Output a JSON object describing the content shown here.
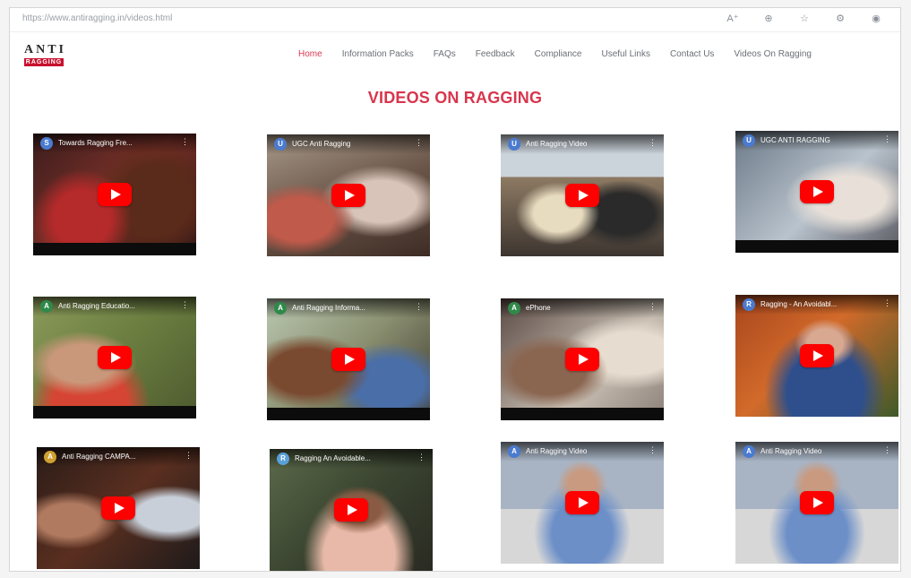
{
  "browser": {
    "url": "https://www.antiragging.in/videos.html",
    "icons": [
      "reader-icon",
      "zoom-icon",
      "favorite-icon",
      "extensions-icon",
      "profile-icon"
    ]
  },
  "site": {
    "logo_text": "ANTI",
    "logo_sub": "RAGGING"
  },
  "nav": {
    "items": [
      {
        "label": "Home",
        "active": true
      },
      {
        "label": "Information Packs",
        "active": false
      },
      {
        "label": "FAQs",
        "active": false
      },
      {
        "label": "Feedback",
        "active": false
      },
      {
        "label": "Compliance",
        "active": false
      },
      {
        "label": "Useful Links",
        "active": false
      },
      {
        "label": "Contact Us",
        "active": false
      },
      {
        "label": "Videos On Ragging",
        "active": false
      }
    ]
  },
  "page": {
    "title": "VIDEOS ON RAGGING"
  },
  "videos": [
    {
      "title": "Towards Ragging Fre...",
      "channel": "S"
    },
    {
      "title": "UGC Anti Ragging",
      "channel": "U"
    },
    {
      "title": "Anti Ragging Video",
      "channel": "U"
    },
    {
      "title": "UGC ANTI RAGGING",
      "channel": "U"
    },
    {
      "title": "Anti Ragging Educatio...",
      "channel": "A"
    },
    {
      "title": "Anti Ragging Informa...",
      "channel": "A"
    },
    {
      "title": "ePhone",
      "channel": "A"
    },
    {
      "title": "Ragging - An Avoidabl...",
      "channel": "R"
    },
    {
      "title": "Anti Ragging CAMPA...",
      "channel": "A"
    },
    {
      "title": "Ragging An Avoidable...",
      "channel": "R"
    },
    {
      "title": "Anti Ragging Video",
      "channel": "A"
    },
    {
      "title": "Anti Ragging Video",
      "channel": "A"
    }
  ]
}
